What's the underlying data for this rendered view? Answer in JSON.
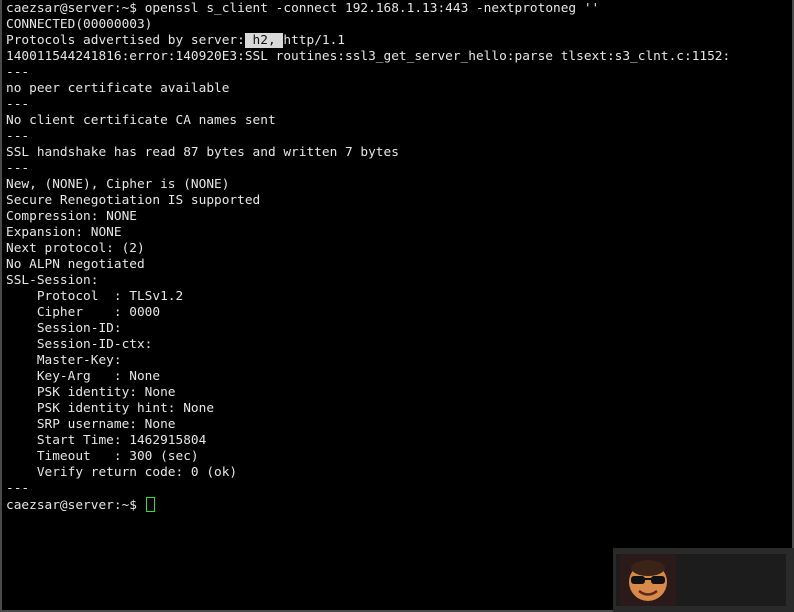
{
  "window": {
    "type": "terminal",
    "colors": {
      "background": "#000000",
      "foreground": "#e6e6e6",
      "highlight_bg": "#d9d9d9",
      "cursor": "#33dd33"
    }
  },
  "terminal": {
    "command": {
      "prompt": "caezsar@server:~$ ",
      "text": "openssl s_client -connect 192.168.1.13:443 -nextprotoneg ''"
    },
    "connected": "CONNECTED(00000003)",
    "protocols": {
      "prefix": "Protocols advertised by server:",
      "highlighted": " h2, ",
      "suffix": "http/1.1"
    },
    "error_line": "140011544241816:error:140920E3:SSL routines:ssl3_get_server_hello:parse tlsext:s3_clnt.c:1152:",
    "separator": "---",
    "no_peer_cert": "no peer certificate available",
    "no_client_ca": "No client certificate CA names sent",
    "handshake": "SSL handshake has read 87 bytes and written 7 bytes",
    "cipher_line": "New, (NONE), Cipher is (NONE)",
    "renegotiation": "Secure Renegotiation IS supported",
    "compression": "Compression: NONE",
    "expansion": "Expansion: NONE",
    "next_protocol": "Next protocol: (2)",
    "alpn": "No ALPN negotiated",
    "ssl_session_header": "SSL-Session:",
    "session": {
      "protocol": "    Protocol  : TLSv1.2",
      "cipher": "    Cipher    : 0000",
      "session_id": "    Session-ID:",
      "session_id_ctx": "    Session-ID-ctx:",
      "master_key": "    Master-Key:",
      "key_arg": "    Key-Arg   : None",
      "psk_identity": "    PSK identity: None",
      "psk_identity_hint": "    PSK identity hint: None",
      "srp_username": "    SRP username: None",
      "start_time": "    Start Time: 1462915804",
      "timeout": "    Timeout   : 300 (sec)",
      "verify": "    Verify return code: 0 (ok)"
    },
    "final_prompt": "caezsar@server:~$ "
  },
  "watermark": {
    "icon": "sunglasses-emoji-logo-icon"
  }
}
